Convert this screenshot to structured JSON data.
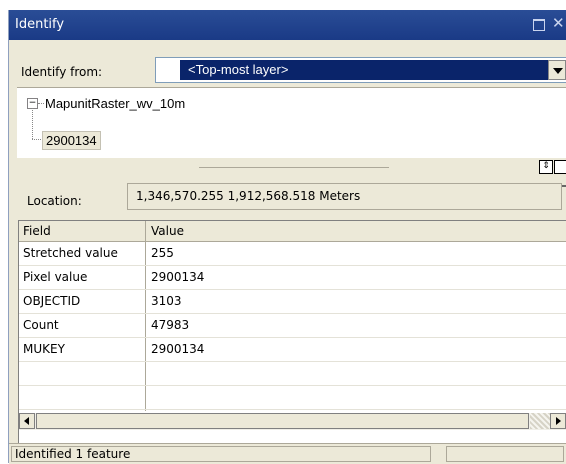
{
  "window": {
    "title": "Identify",
    "title_bar_color": "#1f4391"
  },
  "identify_from": {
    "label": "Identify from:",
    "selected": "<Top-most layer>"
  },
  "tree": {
    "expander": "−",
    "layer": "MapunitRaster_wv_10m",
    "feature": "2900134"
  },
  "location": {
    "label": "Location:",
    "value": "1,346,570.255  1,912,568.518 Meters"
  },
  "table": {
    "columns": [
      "Field",
      "Value"
    ],
    "rows": [
      {
        "field": "Stretched value",
        "value": "255"
      },
      {
        "field": "Pixel value",
        "value": "2900134"
      },
      {
        "field": "OBJECTID",
        "value": "3103"
      },
      {
        "field": "Count",
        "value": "47983"
      },
      {
        "field": "MUKEY",
        "value": "2900134"
      }
    ]
  },
  "status": {
    "text": "Identified 1 feature"
  },
  "icons": {
    "titlebar": [
      "maximize-icon",
      "close-icon"
    ],
    "combo": "dropdown-arrow-icon",
    "tree": "expand-collapse-icon",
    "scroll": [
      "scroll-left-icon",
      "scroll-right-icon"
    ]
  }
}
